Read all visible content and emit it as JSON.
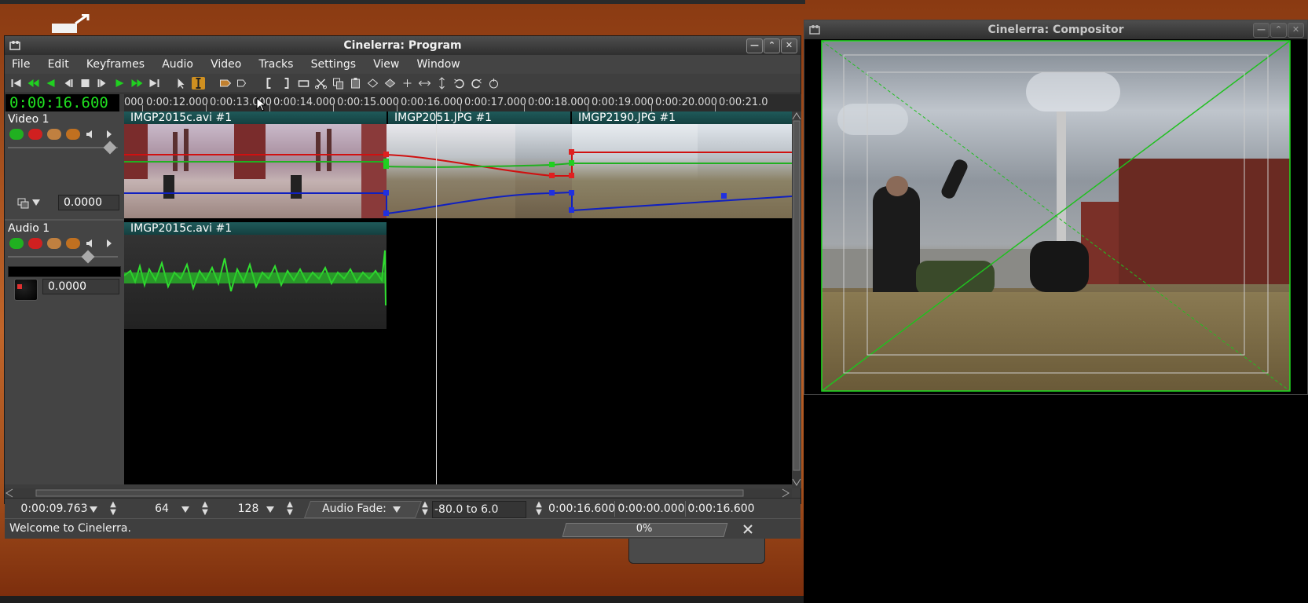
{
  "program": {
    "title": "Cinelerra: Program",
    "menu": [
      "File",
      "Edit",
      "Keyframes",
      "Audio",
      "Video",
      "Tracks",
      "Settings",
      "View",
      "Window"
    ],
    "clock": "0:00:16.600",
    "ruler_ticks": [
      "000",
      "0:00:12.000",
      "0:00:13.000",
      "0:00:14.000",
      "0:00:15.000",
      "0:00:16.000",
      "0:00:17.000",
      "0:00:18.000",
      "0:00:19.000",
      "0:00:20.000",
      "0:00:21.0"
    ],
    "tracks": {
      "video": {
        "name": "Video 1",
        "fade_value": "0.0000"
      },
      "audio": {
        "name": "Audio 1",
        "fade_value": "0.0000"
      }
    },
    "clips": {
      "video": [
        "IMGP2015c.avi #1",
        "IMGP2051.JPG #1",
        "IMGP2190.JPG #1"
      ],
      "audio": [
        "IMGP2015c.avi #1"
      ]
    },
    "zoombar": {
      "sample_zoom": "0:00:09.763",
      "amp_zoom": "64",
      "track_zoom": "128",
      "automation_type": "Audio Fade:",
      "automation_range": "-80.0 to 6.0",
      "selection_start": "0:00:16.600",
      "selection_length": "0:00:00.000",
      "selection_end": "0:00:16.600"
    },
    "status": {
      "message": "Welcome to Cinelerra.",
      "progress_text": "0%",
      "progress": 0
    }
  },
  "compositor": {
    "title": "Cinelerra: Compositor"
  },
  "colors": {
    "accent_green": "#20e020",
    "curve_red": "#d01010",
    "curve_blue": "#1020c0",
    "clip_title": "#1f5a5a"
  }
}
